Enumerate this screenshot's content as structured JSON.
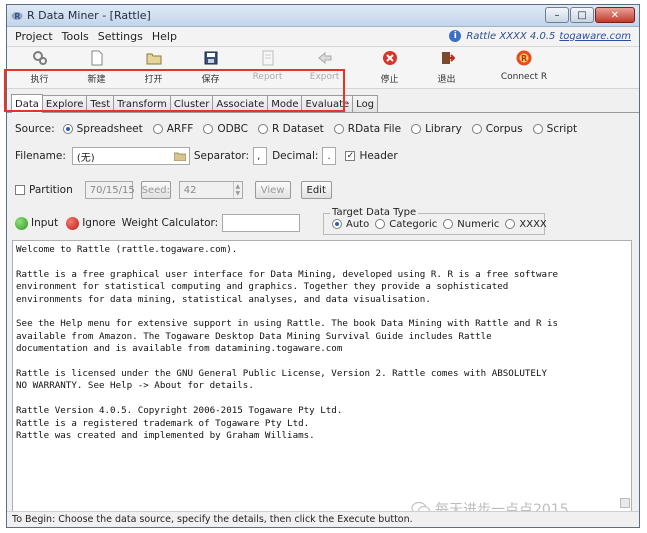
{
  "window": {
    "title": "R Data Miner - [Rattle]",
    "controls": [
      "–",
      "□",
      "✕"
    ]
  },
  "menubar": {
    "items": [
      "Project",
      "Tools",
      "Settings",
      "Help"
    ],
    "version_label": "Rattle XXXX 4.0.5",
    "version_link": "togaware.com"
  },
  "toolbar": {
    "buttons": [
      {
        "label": "执行",
        "icon": "execute-icon",
        "enabled": true
      },
      {
        "label": "新建",
        "icon": "new-icon",
        "enabled": true
      },
      {
        "label": "打开",
        "icon": "open-icon",
        "enabled": true
      },
      {
        "label": "保存",
        "icon": "save-icon",
        "enabled": true
      },
      {
        "label": "Report",
        "icon": "report-icon",
        "enabled": false
      },
      {
        "label": "Export",
        "icon": "export-icon",
        "enabled": false
      },
      {
        "label": "停止",
        "icon": "stop-icon",
        "enabled": true
      },
      {
        "label": "退出",
        "icon": "exit-icon",
        "enabled": true
      },
      {
        "label": "Connect R",
        "icon": "connect-r-icon",
        "enabled": true
      }
    ]
  },
  "tabs": [
    "Data",
    "Explore",
    "Test",
    "Transform",
    "Cluster",
    "Associate",
    "Mode",
    "Evaluate",
    "Log"
  ],
  "source": {
    "label": "Source:",
    "options": [
      "Spreadsheet",
      "ARFF",
      "ODBC",
      "R Dataset",
      "RData File",
      "Library",
      "Corpus",
      "Script"
    ],
    "selected": "Spreadsheet"
  },
  "file": {
    "filename_label": "Filename:",
    "filename_value": "(无)",
    "separator_label": "Separator:",
    "separator_value": ",",
    "decimal_label": "Decimal:",
    "decimal_value": ".",
    "header_label": "Header",
    "header_checked": true
  },
  "partition": {
    "label": "Partition",
    "ratio": "70/15/15",
    "seed_label": "Seed:",
    "seed_value": "42",
    "view_label": "View",
    "edit_label": "Edit"
  },
  "roles": {
    "input_label": "Input",
    "ignore_label": "Ignore",
    "weight_label": "Weight Calculator:",
    "weight_value": ""
  },
  "target_type": {
    "title": "Target Data Type",
    "options": [
      "Auto",
      "Categoric",
      "Numeric",
      "XXXX"
    ],
    "selected": "Auto"
  },
  "log_text": "Welcome to Rattle (rattle.togaware.com).\n\nRattle is a free graphical user interface for Data Mining, developed using R. R is a free software\nenvironment for statistical computing and graphics. Together they provide a sophisticated\nenvironments for data mining, statistical analyses, and data visualisation.\n\nSee the Help menu for extensive support in using Rattle. The book Data Mining with Rattle and R is\navailable from Amazon. The Togaware Desktop Data Mining Survival Guide includes Rattle\ndocumentation and is available from datamining.togaware.com\n\nRattle is licensed under the GNU General Public License, Version 2. Rattle comes with ABSOLUTELY\nNO WARRANTY. See Help -> About for details.\n\nRattle Version 4.0.5. Copyright 2006-2015 Togaware Pty Ltd.\nRattle is a registered trademark of Togaware Pty Ltd.\nRattle was created and implemented by Graham Williams.",
  "watermark": "每天进步一点点2015",
  "status": "To Begin: Choose the data source, specify the details, then click the Execute button.",
  "colors": {
    "highlight_box": "#e8322d",
    "titlebar": "#c4d5ea"
  }
}
